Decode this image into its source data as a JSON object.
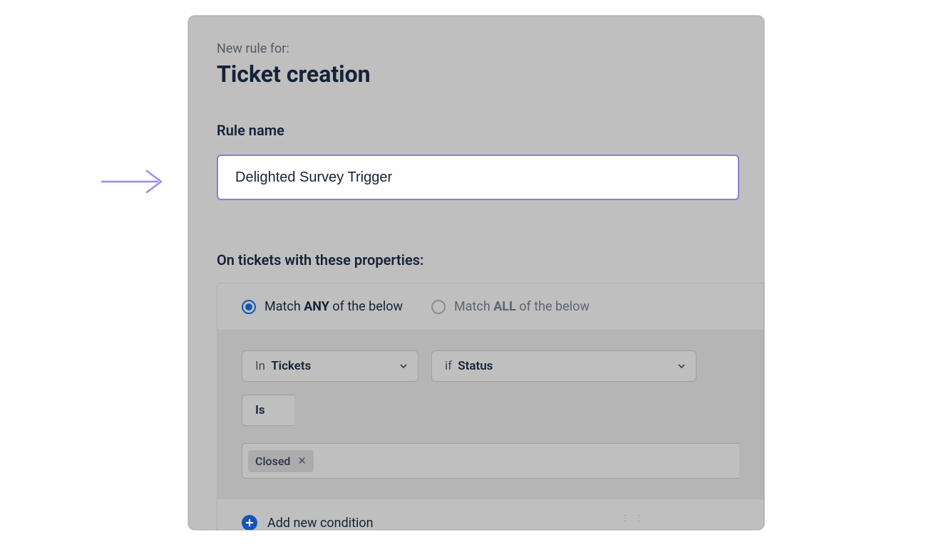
{
  "header": {
    "sub": "New rule for:",
    "title": "Ticket creation"
  },
  "rule_name": {
    "label": "Rule name",
    "value": "Delighted Survey Trigger"
  },
  "conditions": {
    "section_label": "On tickets with these properties:",
    "match_any": {
      "pre": "Match ",
      "bold": "ANY",
      "post": " of the below"
    },
    "match_all": {
      "pre": "Match ",
      "bold": "ALL",
      "post": " of the below"
    },
    "in_prefix": "In ",
    "in_value": "Tickets",
    "if_prefix": "if ",
    "if_value": "Status",
    "op_value": "Is",
    "tag": "Closed",
    "add": "Add new condition"
  }
}
